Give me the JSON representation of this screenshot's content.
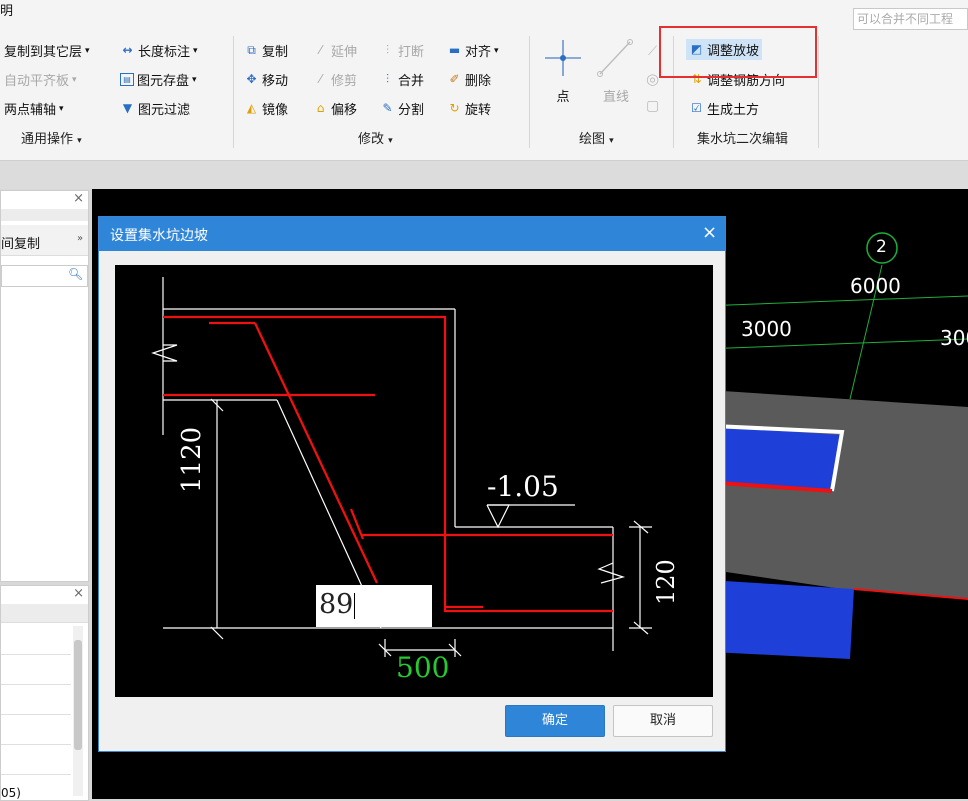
{
  "menu": {
    "partial": "明"
  },
  "search": {
    "placeholder": "可以合并不同工程"
  },
  "ribbon": {
    "general": {
      "items": [
        "复制到其它层",
        "自动平齐板",
        "两点辅轴",
        "长度标注",
        "图元存盘",
        "图元过滤"
      ],
      "label": "通用操作"
    },
    "modify": {
      "items": [
        "复制",
        "移动",
        "镜像",
        "延伸",
        "修剪",
        "偏移",
        "打断",
        "合并",
        "分割",
        "对齐",
        "删除",
        "旋转"
      ],
      "label": "修改"
    },
    "draw": {
      "point": "点",
      "line": "直线",
      "label": "绘图"
    },
    "sump": {
      "items": [
        "调整放坡",
        "调整钢筋方向",
        "生成土方"
      ],
      "label": "集水坑二次编辑"
    }
  },
  "left_panel": {
    "copy_label": "间复制",
    "bottom_text": "05)"
  },
  "canvas": {
    "axis_number": "2",
    "dims": [
      "6000",
      "3000",
      "300"
    ]
  },
  "dialog": {
    "title": "设置集水坑边坡",
    "elevation": "-1.05",
    "dim_1120": "1120",
    "dim_120": "120",
    "dim_500": "500",
    "input_value": "89",
    "ok": "确定",
    "cancel": "取消"
  }
}
